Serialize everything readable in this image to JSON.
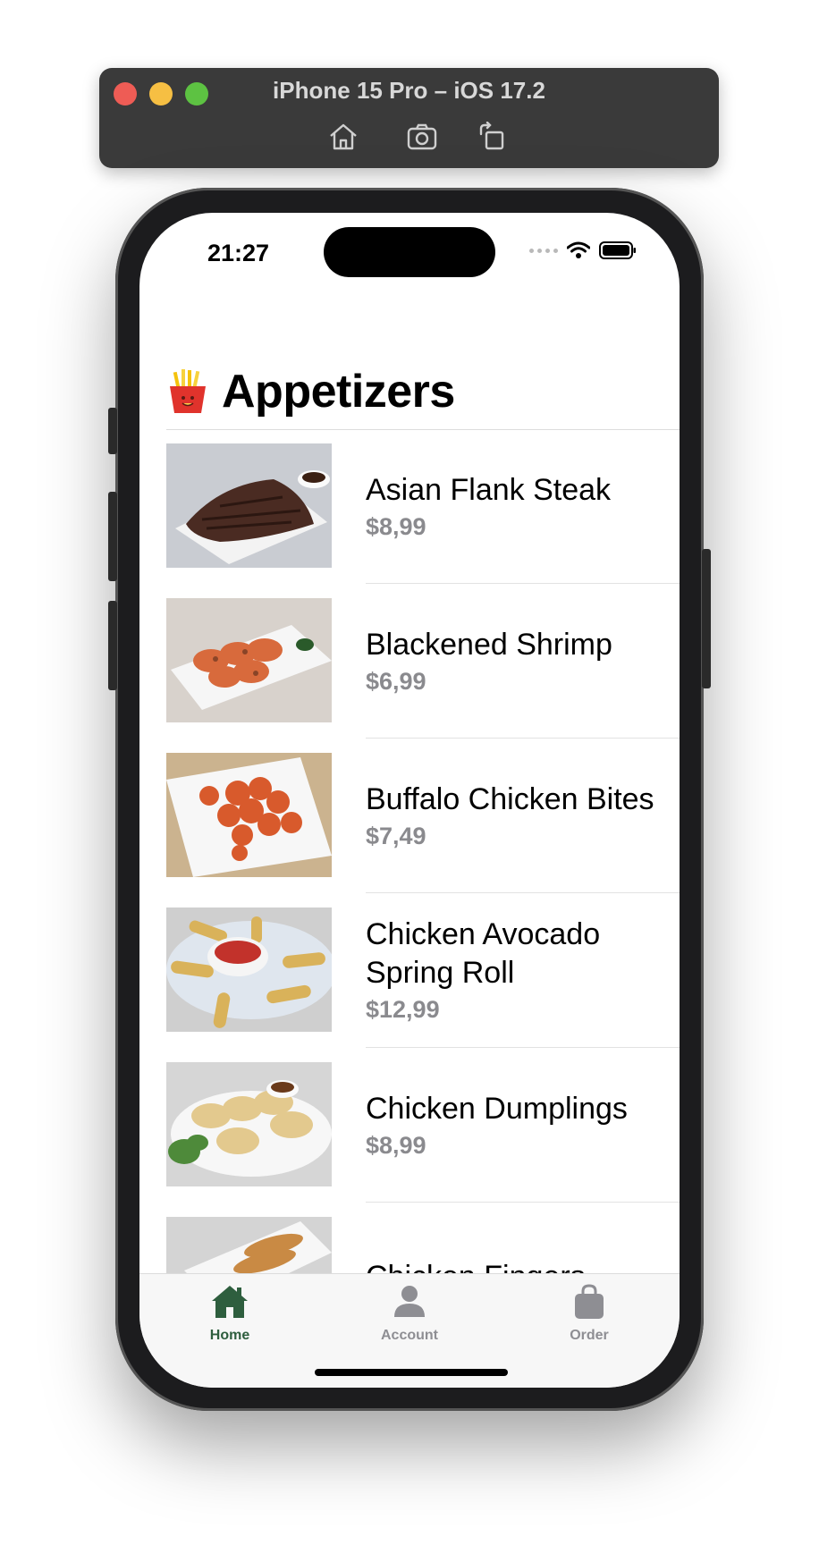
{
  "simulator": {
    "title": "iPhone 15 Pro – iOS 17.2",
    "tools": [
      "home-icon",
      "screenshot-icon",
      "rotate-icon"
    ]
  },
  "status_bar": {
    "time": "21:27"
  },
  "header": {
    "emoji_icon": "fries-icon",
    "title": "Appetizers"
  },
  "items": [
    {
      "name": "Asian Flank Steak",
      "price": "$8,99",
      "image": "steak-image"
    },
    {
      "name": "Blackened Shrimp",
      "price": "$6,99",
      "image": "shrimp-image"
    },
    {
      "name": "Buffalo Chicken Bites",
      "price": "$7,49",
      "image": "chicken-bites-image"
    },
    {
      "name": "Chicken Avocado Spring Roll",
      "price": "$12,99",
      "image": "spring-roll-image"
    },
    {
      "name": "Chicken Dumplings",
      "price": "$8,99",
      "image": "dumplings-image"
    },
    {
      "name": "Chicken Fingers",
      "price": "",
      "image": "chicken-fingers-image"
    }
  ],
  "tabs": [
    {
      "label": "Home",
      "icon": "home-icon",
      "active": true
    },
    {
      "label": "Account",
      "icon": "person-icon",
      "active": false
    },
    {
      "label": "Order",
      "icon": "bag-icon",
      "active": false
    }
  ],
  "colors": {
    "accent": "#2e5e3e",
    "inactive": "#8e8e93",
    "price": "#8a8a8e"
  }
}
